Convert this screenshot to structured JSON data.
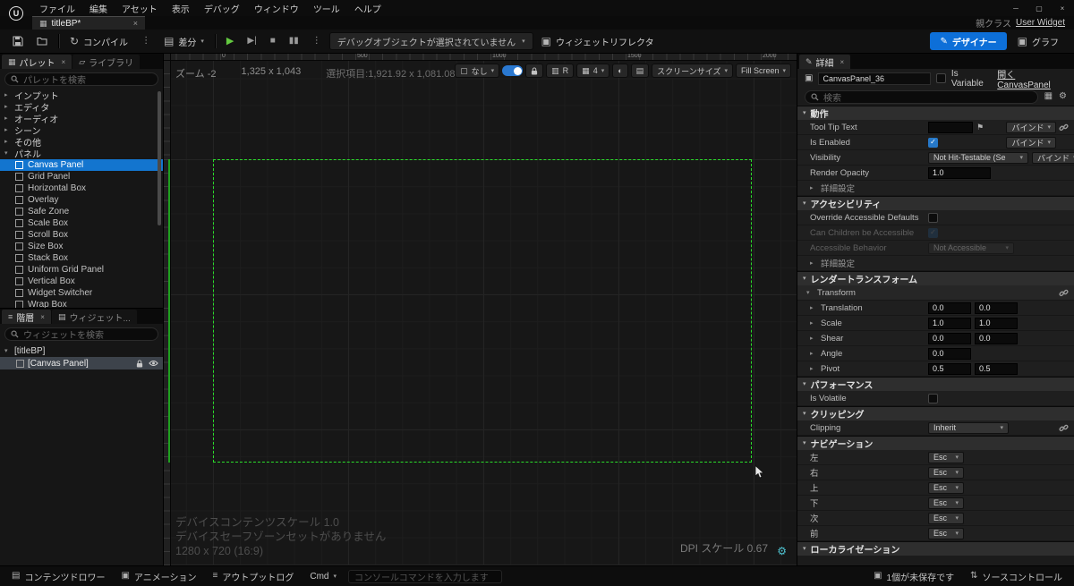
{
  "icons": {
    "minimize": "─",
    "maximize": "▢",
    "close": "×",
    "chevron_down": "▾",
    "arrow_right": "▸",
    "arrow_down": "▾",
    "check": "✓",
    "kebab": "⋮",
    "play": "▶",
    "step": "▶|",
    "stop": "■",
    "pause": "▮▮",
    "gear": "⚙",
    "flag": "⚑",
    "grid": "▦",
    "sheet": "▤",
    "box": "▣",
    "outline": "▢",
    "circle_half": "◐",
    "rows": "▥",
    "compile": "↻",
    "pencil": "✎",
    "updown": "⇅",
    "hamburger": "≡",
    "folder": "▱",
    "logo": "U"
  },
  "titlebar": {
    "menu_items": [
      "ファイル",
      "編集",
      "アセット",
      "表示",
      "デバッグ",
      "ウィンドウ",
      "ツール",
      "ヘルプ"
    ]
  },
  "tabrow": {
    "tab_title": "titleBP*",
    "parent_class_label": "親クラス",
    "parent_class_value": "User Widget"
  },
  "toolbar": {
    "compile_label": "コンパイル",
    "diff_label": "差分",
    "debug_object_label": "デバッグオブジェクトが選択されていません",
    "widget_reflector_label": "ウィジェットリフレクタ",
    "designer_label": "デザイナー",
    "graph_label": "グラフ"
  },
  "palette": {
    "tab_label": "パレット",
    "library_tab_label": "ライブラリ",
    "search_placeholder": "パレットを検索",
    "categories": [
      "インプット",
      "エディタ",
      "オーディオ",
      "シーン",
      "その他"
    ],
    "panel_category_label": "パネル",
    "items": [
      {
        "label": "Canvas Panel",
        "selected": true
      },
      {
        "label": "Grid Panel"
      },
      {
        "label": "Horizontal Box"
      },
      {
        "label": "Overlay"
      },
      {
        "label": "Safe Zone"
      },
      {
        "label": "Scale Box"
      },
      {
        "label": "Scroll Box"
      },
      {
        "label": "Size Box"
      },
      {
        "label": "Stack Box"
      },
      {
        "label": "Uniform Grid Panel"
      },
      {
        "label": "Vertical Box"
      },
      {
        "label": "Widget Switcher"
      },
      {
        "label": "Wrap Box"
      }
    ]
  },
  "hierarchy": {
    "tab_label": "階層",
    "widgets_tab_label": "ウィジェット...",
    "search_placeholder": "ウィジェットを検索",
    "root_label": "[titleBP]",
    "child_label": "[Canvas Panel]"
  },
  "viewport": {
    "zoom_label": "ズーム -2",
    "canvas_size": "1,325 x 1,043",
    "selection_info": "選択項目:1,921.92 x 1,081.08",
    "outline_value": "なし",
    "r_label": "R",
    "grid_snap_value": "4",
    "screen_size_label": "スクリーンサイズ",
    "fill_screen_label": "Fill Screen",
    "ruler_ticks": [
      "0",
      "500",
      "1000",
      "1500",
      "2000"
    ],
    "device_content_scale": "デバイスコンテンツスケール 1.0",
    "safe_zone_message": "デバイスセーフゾーンセットがありません",
    "resolution": "1280 x 720 (16:9)",
    "dpi_scale": "DPI スケール 0.67"
  },
  "details": {
    "tab_label": "詳細",
    "name_value": "CanvasPanel_36",
    "is_variable_label": "Is Variable",
    "open_link": "開くCanvasPanel",
    "search_placeholder": "検索",
    "bind_label": "バインド",
    "sections": {
      "behavior": "動作",
      "accessibility": "アクセシビリティ",
      "render_transform": "レンダートランスフォーム",
      "performance": "パフォーマンス",
      "clipping": "クリッピング",
      "navigation": "ナビゲーション",
      "localization": "ローカライゼーション"
    },
    "behavior_rows": {
      "tooltip_label": "Tool Tip Text",
      "is_enabled_label": "Is Enabled",
      "visibility_label": "Visibility",
      "visibility_value": "Not Hit-Testable (Se",
      "render_opacity_label": "Render Opacity",
      "render_opacity_value": "1.0",
      "advanced_label": "詳細設定"
    },
    "accessibility_rows": {
      "override_label": "Override Accessible Defaults",
      "children_label": "Can Children be Accessible",
      "behavior_label": "Accessible Behavior",
      "behavior_value": "Not Accessible",
      "advanced_label": "詳細設定"
    },
    "transform_rows": {
      "transform_label": "Transform",
      "translation_label": "Translation",
      "translation_x": "0.0",
      "translation_y": "0.0",
      "scale_label": "Scale",
      "scale_x": "1.0",
      "scale_y": "1.0",
      "shear_label": "Shear",
      "shear_x": "0.0",
      "shear_y": "0.0",
      "angle_label": "Angle",
      "angle_value": "0.0",
      "pivot_label": "Pivot",
      "pivot_x": "0.5",
      "pivot_y": "0.5"
    },
    "performance_rows": {
      "is_volatile_label": "Is Volatile"
    },
    "clipping_rows": {
      "clipping_label": "Clipping",
      "clipping_value": "Inherit"
    },
    "navigation_rows": [
      {
        "label": "左",
        "value": "Esc"
      },
      {
        "label": "右",
        "value": "Esc"
      },
      {
        "label": "上",
        "value": "Esc"
      },
      {
        "label": "下",
        "value": "Esc"
      },
      {
        "label": "次",
        "value": "Esc"
      },
      {
        "label": "前",
        "value": "Esc"
      }
    ]
  },
  "statusbar": {
    "content_drawer_label": "コンテンツドロワー",
    "animation_label": "アニメーション",
    "output_log_label": "アウトプットログ",
    "cmd_label": "Cmd",
    "console_placeholder": "コンソールコマンドを入力します",
    "unsaved_label": "1個が未保存です",
    "source_control_label": "ソースコントロール"
  }
}
